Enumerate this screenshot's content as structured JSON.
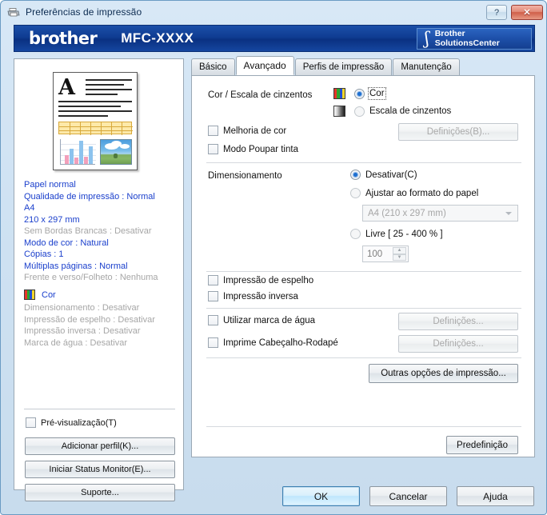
{
  "window": {
    "title": "Preferências de impressão",
    "icon": "printer-icon",
    "help_button": "?",
    "close_button": "✕"
  },
  "banner": {
    "logo": "brother",
    "model": "MFC-XXXX",
    "solutions_line1": "Brother",
    "solutions_line2": "SolutionsCenter",
    "swoosh_icon": "brother-swoosh-icon",
    "bg_color": "#0f3c92"
  },
  "left_panel": {
    "preview_alt": "document-preview-thumbnail",
    "settings": [
      {
        "text": "Papel normal",
        "state": "on"
      },
      {
        "text": "Qualidade de impressão : Normal",
        "state": "on"
      },
      {
        "text": "A4",
        "state": "on"
      },
      {
        "text": "210 x 297 mm",
        "state": "on"
      },
      {
        "text": "Sem Bordas Brancas : Desativar",
        "state": "off"
      },
      {
        "text": "Modo de cor : Natural",
        "state": "on"
      },
      {
        "text": "Cópias : 1",
        "state": "on"
      },
      {
        "text": "Múltiplas páginas : Normal",
        "state": "on"
      },
      {
        "text": "Frente e verso/Folheto : Nenhuma",
        "state": "off"
      }
    ],
    "color_label": "Cor",
    "color_icon": "color-bars-icon",
    "settings2": [
      {
        "text": "Dimensionamento : Desativar",
        "state": "off"
      },
      {
        "text": "Impressão de espelho : Desativar",
        "state": "off"
      },
      {
        "text": "Impressão inversa : Desativar",
        "state": "off"
      },
      {
        "text": "Marca de água : Desativar",
        "state": "off"
      }
    ],
    "preview_checkbox": {
      "label": "Pré-visualização(T)",
      "accel": "T",
      "checked": false
    },
    "buttons": [
      {
        "label": "Adicionar perfil(K)...",
        "accel": "K"
      },
      {
        "label": "Iniciar Status Monitor(E)...",
        "accel": "E"
      },
      {
        "label": "Suporte...",
        "accel": "S"
      }
    ]
  },
  "tabs": [
    {
      "label": "Básico",
      "active": false
    },
    {
      "label": "Avançado",
      "active": true
    },
    {
      "label": "Perfis de impressão",
      "active": false
    },
    {
      "label": "Manutenção",
      "active": false
    }
  ],
  "advanced": {
    "color_grayscale": {
      "label": "Cor / Escala de cinzentos",
      "options": [
        {
          "label": "Cor",
          "accel": "C",
          "selected": true,
          "icon": "color-bars-icon",
          "focused": true
        },
        {
          "label": "Escala de cinzentos",
          "accel": "z",
          "selected": false,
          "icon": "grayscale-gradient-icon",
          "focused": false
        }
      ]
    },
    "color_enhancement": {
      "label": "Melhoria de cor",
      "accel": "M",
      "checked": false,
      "settings_button": "Definições(B)...",
      "settings_button_enabled": false
    },
    "ink_save": {
      "label": "Modo Poupar tinta",
      "accel": "M",
      "checked": false
    },
    "scaling": {
      "label": "Dimensionamento",
      "options": [
        {
          "label": "Desativar(C)",
          "accel": "C",
          "selected": true
        },
        {
          "label": "Ajustar ao formato do papel",
          "accel": "r",
          "selected": false
        },
        {
          "label": "Livre [ 25 - 400 % ]",
          "accel": "L",
          "selected": false
        }
      ],
      "paper_size_value": "A4 (210 x 297 mm)",
      "paper_size_enabled": false,
      "free_value": "100",
      "free_enabled": false
    },
    "mirror_print": {
      "label": "Impressão de espelho",
      "accel": "h",
      "checked": false
    },
    "reverse_print": {
      "label": "Impressão inversa",
      "accel": "v",
      "checked": false
    },
    "watermark": {
      "label": "Utilizar marca de água",
      "accel": "z",
      "checked": false,
      "settings_button": "Definições...",
      "settings_button_enabled": false
    },
    "header_footer": {
      "label": "Imprime Cabeçalho-Rodapé",
      "accel": "I",
      "checked": false,
      "settings_button": "Definições...",
      "settings_button_enabled": false
    },
    "other_options_button": {
      "label": "Outras opções de impressão...",
      "accel": "O"
    },
    "default_button": {
      "label": "Predefinição",
      "accel": "P"
    }
  },
  "footer": {
    "ok": "OK",
    "cancel": "Cancelar",
    "help": "Ajuda"
  }
}
